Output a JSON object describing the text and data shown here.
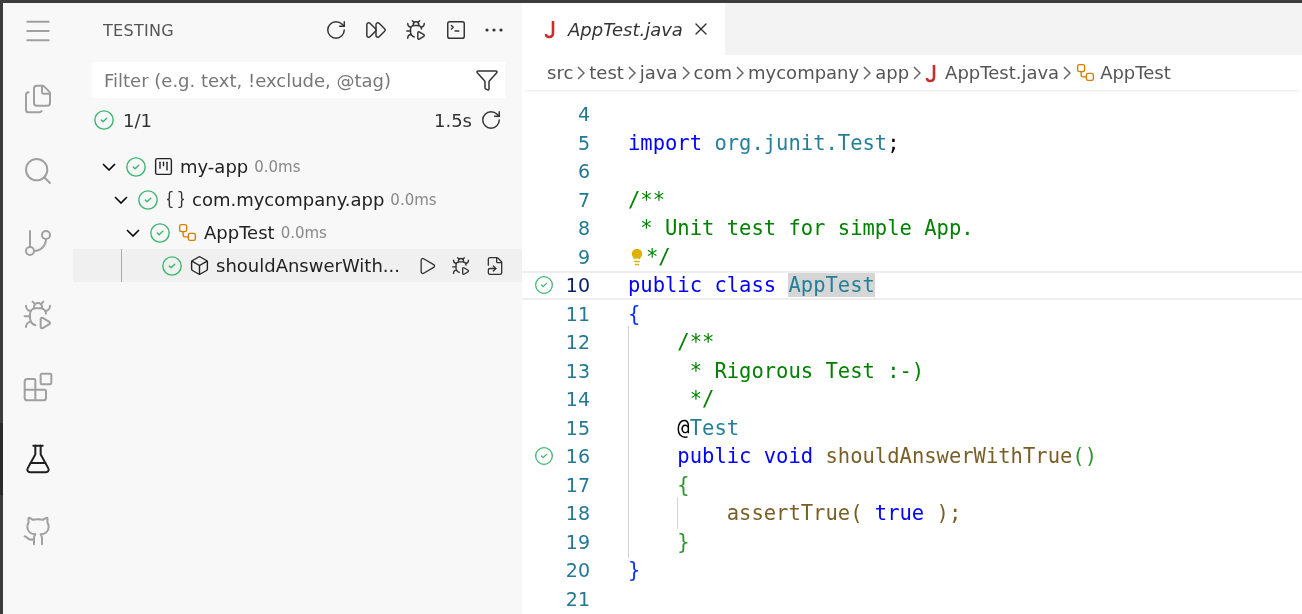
{
  "activity_bar": {
    "items": [
      {
        "kind": "menu",
        "selected": false
      },
      {
        "kind": "explorer",
        "selected": false
      },
      {
        "kind": "search",
        "selected": false
      },
      {
        "kind": "source-control",
        "selected": false
      },
      {
        "kind": "run-debug",
        "selected": false
      },
      {
        "kind": "extensions",
        "selected": false
      },
      {
        "kind": "testing",
        "selected": true
      },
      {
        "kind": "github",
        "selected": false
      }
    ]
  },
  "sidebar": {
    "title": "TESTING",
    "actions": [
      {
        "kind": "refresh"
      },
      {
        "kind": "run-all"
      },
      {
        "kind": "debug-all"
      },
      {
        "kind": "terminal"
      },
      {
        "kind": "more"
      }
    ],
    "filter": {
      "placeholder": "Filter (e.g. text, !exclude, @tag)"
    },
    "summary": {
      "passed": true,
      "count": "1/1",
      "duration": "1.5s"
    },
    "tree": [
      {
        "kind": "project",
        "label": "my-app",
        "duration": "0.0ms",
        "passed": true,
        "expanded": true,
        "selected": false,
        "children": [
          {
            "kind": "package",
            "label": "com.mycompany.app",
            "duration": "0.0ms",
            "passed": true,
            "expanded": true,
            "selected": false,
            "children": [
              {
                "kind": "class",
                "label": "AppTest",
                "duration": "0.0ms",
                "passed": true,
                "expanded": true,
                "selected": false,
                "children": [
                  {
                    "kind": "method",
                    "label": "shouldAnswerWith...",
                    "passed": true,
                    "selected": true
                  }
                ]
              }
            ]
          }
        ]
      }
    ]
  },
  "tabs": [
    {
      "label": "AppTest.java",
      "selected": true,
      "preview": true
    }
  ],
  "breadcrumbs": [
    {
      "label": "src",
      "kind": "folder"
    },
    {
      "label": "test",
      "kind": "folder"
    },
    {
      "label": "java",
      "kind": "folder"
    },
    {
      "label": "com",
      "kind": "folder"
    },
    {
      "label": "mycompany",
      "kind": "folder"
    },
    {
      "label": "app",
      "kind": "folder"
    },
    {
      "label": "AppTest.java",
      "kind": "java-file"
    },
    {
      "label": "AppTest",
      "kind": "class"
    }
  ],
  "editor": {
    "lines": [
      {
        "number": "4",
        "current": false
      },
      {
        "number": "5",
        "current": false,
        "tokens": [
          {
            "kind": "keyword",
            "text": "import "
          },
          {
            "kind": "type",
            "text": "org.junit.Test"
          },
          {
            "kind": "plain",
            "text": ";"
          }
        ]
      },
      {
        "number": "6",
        "current": false
      },
      {
        "number": "7",
        "current": false,
        "tokens": [
          {
            "kind": "comment",
            "text": "/**"
          }
        ]
      },
      {
        "number": "8",
        "current": false,
        "tokens": [
          {
            "kind": "comment",
            "text": " * Unit test for simple App."
          }
        ]
      },
      {
        "number": "9",
        "current": false,
        "lightbulb": true,
        "tokens": [
          {
            "kind": "comment",
            "text": "*/"
          }
        ]
      },
      {
        "number": "10",
        "current": true,
        "passed": true,
        "tokens": [
          {
            "kind": "keyword",
            "text": "public "
          },
          {
            "kind": "keyword",
            "text": "class "
          },
          {
            "kind": "type",
            "text": "AppTest",
            "highlighted": true
          }
        ]
      },
      {
        "number": "11",
        "current": false,
        "tokens": [
          {
            "kind": "brace",
            "text": "{"
          }
        ]
      },
      {
        "number": "12",
        "current": false,
        "tokens": [
          {
            "kind": "comment",
            "text": "    /**"
          }
        ]
      },
      {
        "number": "13",
        "current": false,
        "tokens": [
          {
            "kind": "comment",
            "text": "     * Rigorous Test :-)"
          }
        ]
      },
      {
        "number": "14",
        "current": false,
        "tokens": [
          {
            "kind": "comment",
            "text": "     */"
          }
        ]
      },
      {
        "number": "15",
        "current": false,
        "tokens": [
          {
            "kind": "plain",
            "text": "    @"
          },
          {
            "kind": "type",
            "text": "Test"
          }
        ]
      },
      {
        "number": "16",
        "current": false,
        "passed": true,
        "tokens": [
          {
            "kind": "keyword",
            "text": "    public "
          },
          {
            "kind": "keyword",
            "text": "void "
          },
          {
            "kind": "function",
            "text": "shouldAnswerWithTrue"
          },
          {
            "kind": "bracket",
            "text": "()"
          }
        ]
      },
      {
        "number": "17",
        "current": false,
        "tokens": [
          {
            "kind": "bracket",
            "text": "    {"
          }
        ]
      },
      {
        "number": "18",
        "current": false,
        "tokens": [
          {
            "kind": "function",
            "text": "        assertTrue( "
          },
          {
            "kind": "keyword",
            "text": "true"
          },
          {
            "kind": "function",
            "text": " );"
          }
        ]
      },
      {
        "number": "19",
        "current": false,
        "tokens": [
          {
            "kind": "bracket",
            "text": "    }"
          }
        ]
      },
      {
        "number": "20",
        "current": false,
        "tokens": [
          {
            "kind": "brace",
            "text": "}"
          }
        ]
      },
      {
        "number": "21",
        "current": false
      }
    ]
  }
}
